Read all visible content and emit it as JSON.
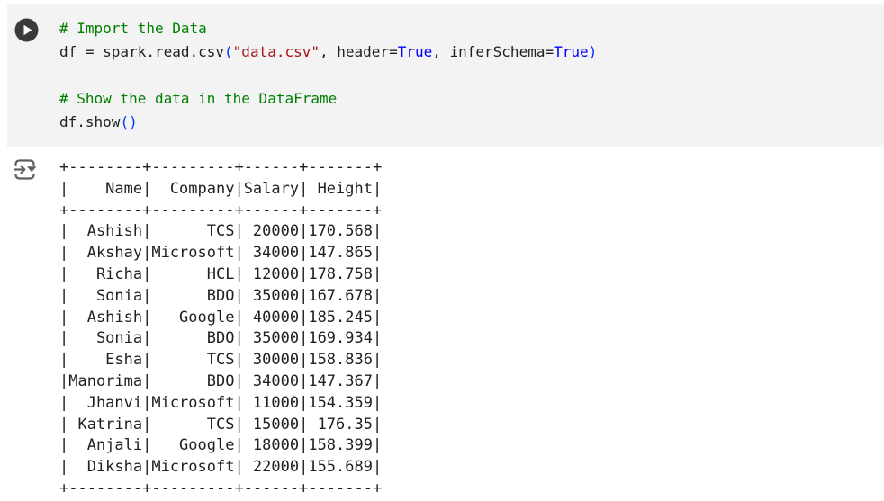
{
  "editor": {
    "page_background": "#ffffff",
    "cell_background": "#f3f3f3"
  },
  "cell": {
    "run_button": {
      "icon": "play-circle-icon",
      "circle_color": "#3b3b3b",
      "glyph_color": "#ffffff"
    },
    "code": {
      "colors": {
        "plain": "#1f1f1f",
        "comment": "#008000",
        "string": "#a31515",
        "constant": "#0000ff",
        "bracket": "#0431fa"
      },
      "lines": [
        [
          {
            "text": "# Import the Data",
            "style": "comment"
          }
        ],
        [
          {
            "text": "df = spark.read.csv",
            "style": "plain"
          },
          {
            "text": "(",
            "style": "bracket"
          },
          {
            "text": "\"data.csv\"",
            "style": "string"
          },
          {
            "text": ", header=",
            "style": "plain"
          },
          {
            "text": "True",
            "style": "constant"
          },
          {
            "text": ", inferSchema=",
            "style": "plain"
          },
          {
            "text": "True",
            "style": "constant"
          },
          {
            "text": ")",
            "style": "bracket"
          }
        ],
        [],
        [
          {
            "text": "# Show the data in the DataFrame",
            "style": "comment"
          }
        ],
        [
          {
            "text": "df.show",
            "style": "plain"
          },
          {
            "text": "()",
            "style": "bracket"
          }
        ]
      ]
    }
  },
  "output": {
    "gutter_icon": "goto-output-icon",
    "icon_color": "#5f5f5f",
    "text_color": "#1f1f1f",
    "table": {
      "headers": [
        "Name",
        "Company",
        "Salary",
        "Height"
      ],
      "rows": [
        [
          "Ashish",
          "TCS",
          "20000",
          "170.568"
        ],
        [
          "Akshay",
          "Microsoft",
          "34000",
          "147.865"
        ],
        [
          "Richa",
          "HCL",
          "12000",
          "178.758"
        ],
        [
          "Sonia",
          "BDO",
          "35000",
          "167.678"
        ],
        [
          "Ashish",
          "Google",
          "40000",
          "185.245"
        ],
        [
          "Sonia",
          "BDO",
          "35000",
          "169.934"
        ],
        [
          "Esha",
          "TCS",
          "30000",
          "158.836"
        ],
        [
          "Manorima",
          "BDO",
          "34000",
          "147.367"
        ],
        [
          "Jhanvi",
          "Microsoft",
          "11000",
          "154.359"
        ],
        [
          "Katrina",
          "TCS",
          "15000",
          "176.35"
        ],
        [
          "Anjali",
          "Google",
          "18000",
          "158.399"
        ],
        [
          "Diksha",
          "Microsoft",
          "22000",
          "155.689"
        ]
      ]
    }
  }
}
